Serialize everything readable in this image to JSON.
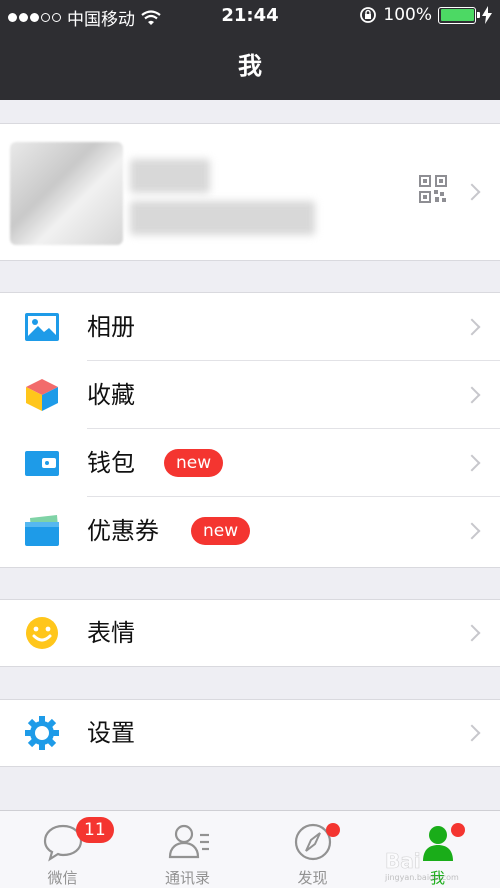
{
  "status_bar": {
    "carrier": "中国移动",
    "time": "21:44",
    "battery": "100%",
    "battery_level": 1.0
  },
  "nav": {
    "title": "我"
  },
  "menu": {
    "album": {
      "label": "相册"
    },
    "favorites": {
      "label": "收藏"
    },
    "wallet": {
      "label": "钱包",
      "badge": "new"
    },
    "coupons": {
      "label": "优惠券",
      "badge": "new"
    },
    "stickers": {
      "label": "表情"
    },
    "settings": {
      "label": "设置"
    }
  },
  "tabs": [
    {
      "label": "微信",
      "badge": "11"
    },
    {
      "label": "通讯录"
    },
    {
      "label": "发现"
    },
    {
      "label": "我"
    }
  ],
  "colors": {
    "nav_bg": "#2e2e32",
    "accent_green": "#1aad19",
    "badge_red": "#f43530",
    "icon_blue": "#1e9be8"
  }
}
